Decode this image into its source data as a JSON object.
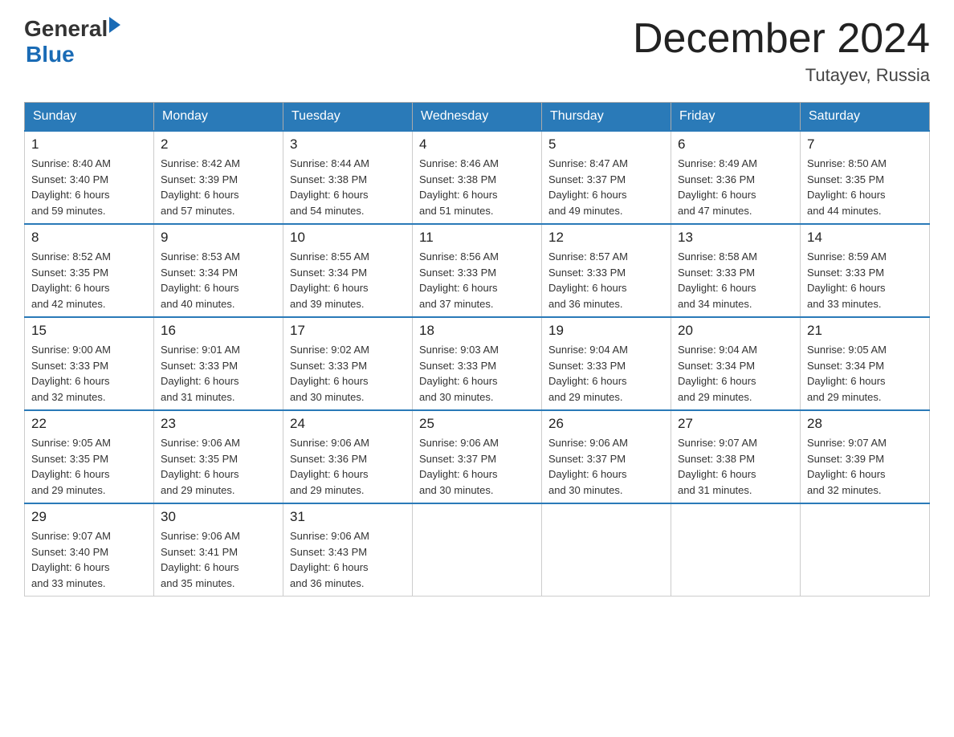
{
  "header": {
    "logo_line1": "General",
    "logo_line2": "Blue",
    "month_title": "December 2024",
    "location": "Tutayev, Russia"
  },
  "weekdays": [
    "Sunday",
    "Monday",
    "Tuesday",
    "Wednesday",
    "Thursday",
    "Friday",
    "Saturday"
  ],
  "weeks": [
    [
      {
        "day": "1",
        "sunrise": "8:40 AM",
        "sunset": "3:40 PM",
        "daylight": "6 hours and 59 minutes."
      },
      {
        "day": "2",
        "sunrise": "8:42 AM",
        "sunset": "3:39 PM",
        "daylight": "6 hours and 57 minutes."
      },
      {
        "day": "3",
        "sunrise": "8:44 AM",
        "sunset": "3:38 PM",
        "daylight": "6 hours and 54 minutes."
      },
      {
        "day": "4",
        "sunrise": "8:46 AM",
        "sunset": "3:38 PM",
        "daylight": "6 hours and 51 minutes."
      },
      {
        "day": "5",
        "sunrise": "8:47 AM",
        "sunset": "3:37 PM",
        "daylight": "6 hours and 49 minutes."
      },
      {
        "day": "6",
        "sunrise": "8:49 AM",
        "sunset": "3:36 PM",
        "daylight": "6 hours and 47 minutes."
      },
      {
        "day": "7",
        "sunrise": "8:50 AM",
        "sunset": "3:35 PM",
        "daylight": "6 hours and 44 minutes."
      }
    ],
    [
      {
        "day": "8",
        "sunrise": "8:52 AM",
        "sunset": "3:35 PM",
        "daylight": "6 hours and 42 minutes."
      },
      {
        "day": "9",
        "sunrise": "8:53 AM",
        "sunset": "3:34 PM",
        "daylight": "6 hours and 40 minutes."
      },
      {
        "day": "10",
        "sunrise": "8:55 AM",
        "sunset": "3:34 PM",
        "daylight": "6 hours and 39 minutes."
      },
      {
        "day": "11",
        "sunrise": "8:56 AM",
        "sunset": "3:33 PM",
        "daylight": "6 hours and 37 minutes."
      },
      {
        "day": "12",
        "sunrise": "8:57 AM",
        "sunset": "3:33 PM",
        "daylight": "6 hours and 36 minutes."
      },
      {
        "day": "13",
        "sunrise": "8:58 AM",
        "sunset": "3:33 PM",
        "daylight": "6 hours and 34 minutes."
      },
      {
        "day": "14",
        "sunrise": "8:59 AM",
        "sunset": "3:33 PM",
        "daylight": "6 hours and 33 minutes."
      }
    ],
    [
      {
        "day": "15",
        "sunrise": "9:00 AM",
        "sunset": "3:33 PM",
        "daylight": "6 hours and 32 minutes."
      },
      {
        "day": "16",
        "sunrise": "9:01 AM",
        "sunset": "3:33 PM",
        "daylight": "6 hours and 31 minutes."
      },
      {
        "day": "17",
        "sunrise": "9:02 AM",
        "sunset": "3:33 PM",
        "daylight": "6 hours and 30 minutes."
      },
      {
        "day": "18",
        "sunrise": "9:03 AM",
        "sunset": "3:33 PM",
        "daylight": "6 hours and 30 minutes."
      },
      {
        "day": "19",
        "sunrise": "9:04 AM",
        "sunset": "3:33 PM",
        "daylight": "6 hours and 29 minutes."
      },
      {
        "day": "20",
        "sunrise": "9:04 AM",
        "sunset": "3:34 PM",
        "daylight": "6 hours and 29 minutes."
      },
      {
        "day": "21",
        "sunrise": "9:05 AM",
        "sunset": "3:34 PM",
        "daylight": "6 hours and 29 minutes."
      }
    ],
    [
      {
        "day": "22",
        "sunrise": "9:05 AM",
        "sunset": "3:35 PM",
        "daylight": "6 hours and 29 minutes."
      },
      {
        "day": "23",
        "sunrise": "9:06 AM",
        "sunset": "3:35 PM",
        "daylight": "6 hours and 29 minutes."
      },
      {
        "day": "24",
        "sunrise": "9:06 AM",
        "sunset": "3:36 PM",
        "daylight": "6 hours and 29 minutes."
      },
      {
        "day": "25",
        "sunrise": "9:06 AM",
        "sunset": "3:37 PM",
        "daylight": "6 hours and 30 minutes."
      },
      {
        "day": "26",
        "sunrise": "9:06 AM",
        "sunset": "3:37 PM",
        "daylight": "6 hours and 30 minutes."
      },
      {
        "day": "27",
        "sunrise": "9:07 AM",
        "sunset": "3:38 PM",
        "daylight": "6 hours and 31 minutes."
      },
      {
        "day": "28",
        "sunrise": "9:07 AM",
        "sunset": "3:39 PM",
        "daylight": "6 hours and 32 minutes."
      }
    ],
    [
      {
        "day": "29",
        "sunrise": "9:07 AM",
        "sunset": "3:40 PM",
        "daylight": "6 hours and 33 minutes."
      },
      {
        "day": "30",
        "sunrise": "9:06 AM",
        "sunset": "3:41 PM",
        "daylight": "6 hours and 35 minutes."
      },
      {
        "day": "31",
        "sunrise": "9:06 AM",
        "sunset": "3:43 PM",
        "daylight": "6 hours and 36 minutes."
      },
      null,
      null,
      null,
      null
    ]
  ],
  "labels": {
    "sunrise": "Sunrise:",
    "sunset": "Sunset:",
    "daylight": "Daylight:"
  }
}
